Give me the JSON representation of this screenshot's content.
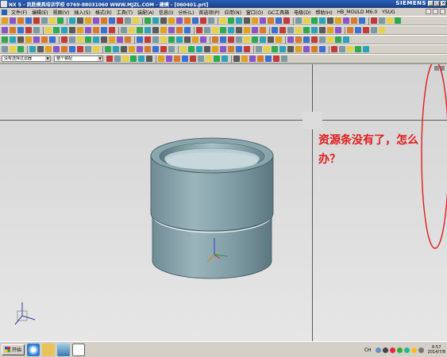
{
  "window": {
    "title": "NX 5 - 凯胜模具培训学校 0769-88031060 WWW.MJZL.COM - 建模 - [060401.prt]",
    "brand": "SIEMENS",
    "min_glyph": "_",
    "max_glyph": "□",
    "close_glyph": "×"
  },
  "menu": {
    "items": [
      "文件(F)",
      "编辑(E)",
      "视图(V)",
      "插入(S)",
      "格式(R)",
      "工具(T)",
      "装配(A)",
      "信息(I)",
      "分析(L)",
      "首选项(P)",
      "应用(N)",
      "窗口(O)",
      "GC工具箱",
      "电极(D)",
      "帮助(H)",
      "HB_MOULD M6.0",
      "YSUG"
    ]
  },
  "selection_bar": {
    "filter_value": "没有选择过滤器",
    "scope_value": "整个装配"
  },
  "annotation": {
    "text": "资源条没有了，怎么办？",
    "color": "#e21b1b"
  },
  "taskbar": {
    "start_label": "开始",
    "ime_label": "CH",
    "clock_time": "6:57",
    "clock_date": "2014/7/8"
  },
  "colors": {
    "part_body": "#7d9aa3",
    "viewport_bg": "#dcdcdc",
    "highlight_circle": "#e21b1b"
  }
}
